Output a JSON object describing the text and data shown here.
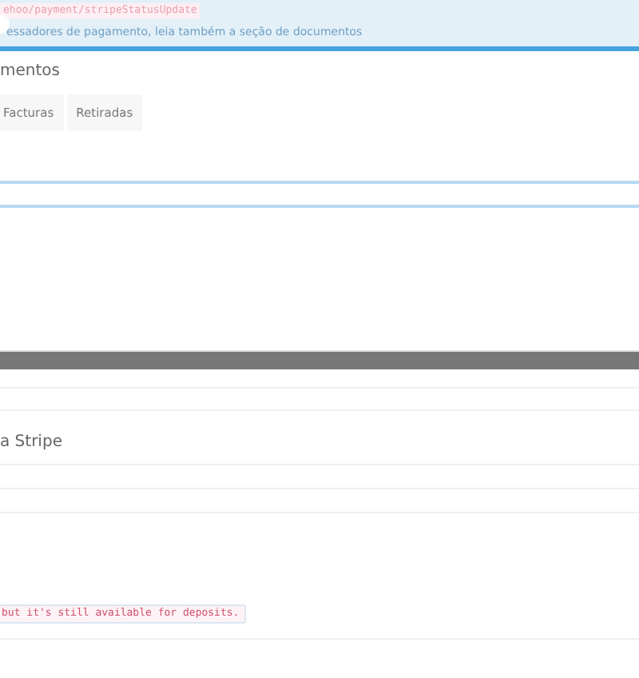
{
  "notice": {
    "code": "ehoo/payment/stripeStatusUpdate",
    "text": "essadores de pagamento, leia também a seção de documentos"
  },
  "section": {
    "title": "mentos"
  },
  "tabs": [
    {
      "label": "Facturas",
      "selected": false
    },
    {
      "label": "Retiradas",
      "selected": false
    }
  ],
  "stripe": {
    "label": "a Stripe"
  },
  "warning": {
    "code": "but it's still available for deposits."
  }
}
